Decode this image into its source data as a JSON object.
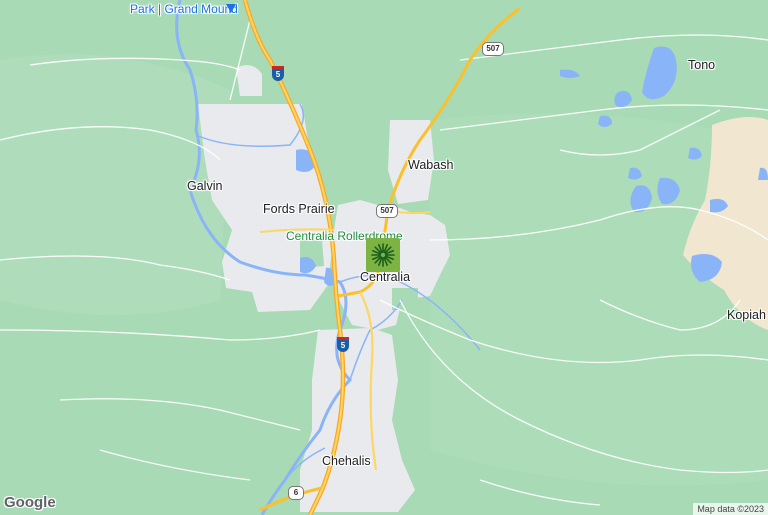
{
  "map": {
    "labels": {
      "top_place": "Park | Grand Mound",
      "tono": "Tono",
      "wabash": "Wabash",
      "galvin": "Galvin",
      "fords_prairie": "Fords Prairie",
      "centralia_rollerdrome": "Centralia Rollerdrome",
      "centralia": "Centralia",
      "kopiah": "Kopiah",
      "chehalis": "Chehalis"
    },
    "shields": {
      "i5_north": "5",
      "i5_south": "5",
      "sr507_north": "507",
      "sr507_center": "507",
      "us6": "6"
    },
    "marker_icon": "sunburst-icon",
    "logo": "Google",
    "attribution": "Map data ©2023"
  },
  "colors": {
    "land": "#a8dab5",
    "urban": "#e8eaed",
    "water": "#8ab4f8",
    "highway": "#fbc02d",
    "marker": "#7cb342"
  }
}
